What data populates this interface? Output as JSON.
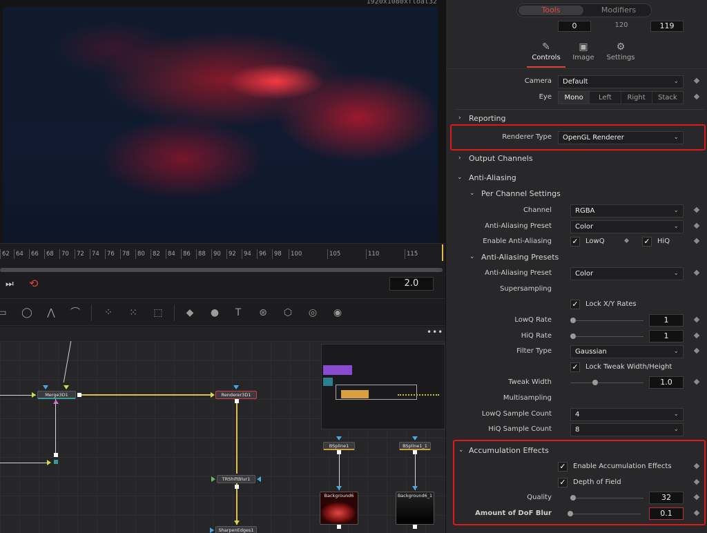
{
  "viewer": {
    "resolution": "1920x1080xfloat32"
  },
  "timeline": {
    "ticks": [
      "62",
      "64",
      "66",
      "68",
      "70",
      "72",
      "74",
      "76",
      "78",
      "80",
      "82",
      "84",
      "86",
      "88",
      "90",
      "92",
      "94",
      "96",
      "98",
      "100",
      "105",
      "110",
      "115"
    ]
  },
  "transport": {
    "speed": "2.0"
  },
  "nodes": {
    "merge": "Merge3D1",
    "renderer": "Renderer3D1",
    "triblur": "TRShiftBlur1",
    "sharpen": "SharpenEdges1",
    "bspline1": "BSpline1",
    "bspline2": "BSpline1_1",
    "bg1": "Background6",
    "bg2": "Background6_1"
  },
  "inspector": {
    "tabs": {
      "tools": "Tools",
      "modifiers": "Modifiers"
    },
    "frames": {
      "start": "0",
      "mid": "120",
      "end": "119"
    },
    "subtabs": {
      "controls": "Controls",
      "image": "Image",
      "settings": "Settings"
    },
    "camera": {
      "label": "Camera",
      "value": "Default"
    },
    "eye": {
      "label": "Eye",
      "options": [
        "Mono",
        "Left",
        "Right",
        "Stack"
      ]
    },
    "reporting": "Reporting",
    "renderer": {
      "label": "Renderer Type",
      "value": "OpenGL Renderer"
    },
    "output_channels": "Output Channels",
    "anti_aliasing": "Anti-Aliasing",
    "per_channel": "Per Channel Settings",
    "channel": {
      "label": "Channel",
      "value": "RGBA"
    },
    "aa_preset": {
      "label": "Anti-Aliasing Preset",
      "value": "Color"
    },
    "enable_aa": {
      "label": "Enable Anti-Aliasing",
      "lowq": "LowQ",
      "hiq": "HiQ"
    },
    "aa_presets": "Anti-Aliasing Presets",
    "aa_preset2": {
      "label": "Anti-Aliasing Preset",
      "value": "Color"
    },
    "supersampling": "Supersampling",
    "lock_xy": "Lock X/Y Rates",
    "lowq_rate": {
      "label": "LowQ Rate",
      "value": "1"
    },
    "hiq_rate": {
      "label": "HiQ Rate",
      "value": "1"
    },
    "filter_type": {
      "label": "Filter Type",
      "value": "Gaussian"
    },
    "lock_tweak": "Lock Tweak Width/Height",
    "tweak_width": {
      "label": "Tweak Width",
      "value": "1.0"
    },
    "multisampling": "Multisampling",
    "lowq_count": {
      "label": "LowQ Sample Count",
      "value": "4"
    },
    "hiq_count": {
      "label": "HiQ Sample Count",
      "value": "8"
    },
    "accum": "Accumulation Effects",
    "enable_accum": "Enable Accumulation Effects",
    "dof": "Depth of Field",
    "quality": {
      "label": "Quality",
      "value": "32"
    },
    "dof_blur": {
      "label": "Amount of DoF Blur",
      "value": "0.1"
    }
  },
  "colors": {
    "accent": "#e04040",
    "highlight": "#e01818"
  }
}
